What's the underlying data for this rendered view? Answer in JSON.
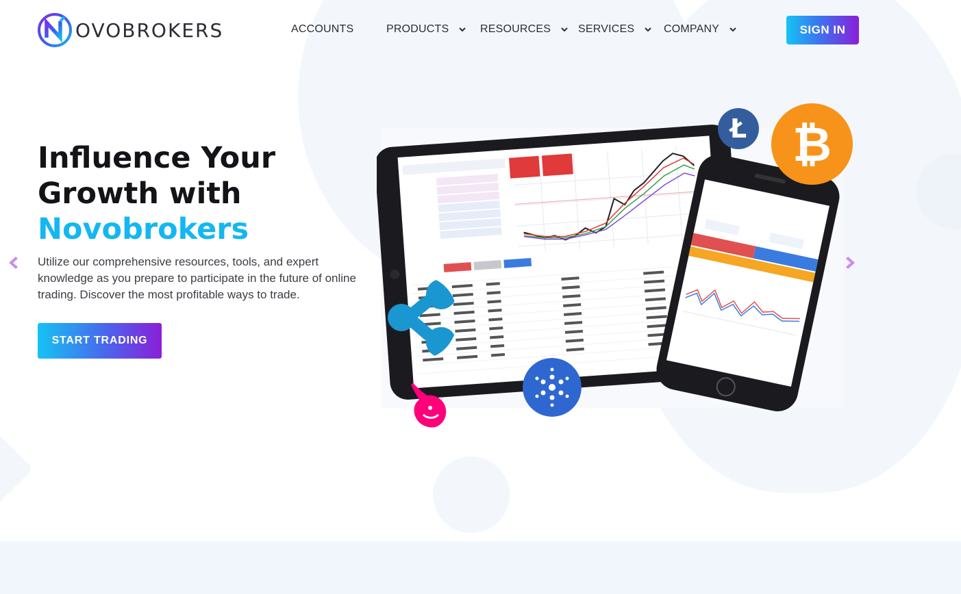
{
  "brand": {
    "logo_letter": "N",
    "name": "OVOBROKERS"
  },
  "nav": {
    "items": [
      {
        "label": "ACCOUNTS",
        "has_dropdown": false
      },
      {
        "label": "PRODUCTS",
        "has_dropdown": true
      },
      {
        "label": "RESOURCES",
        "has_dropdown": true
      },
      {
        "label": "SERVICES",
        "has_dropdown": true
      },
      {
        "label": "COMPANY",
        "has_dropdown": true
      }
    ],
    "signin_label": "SIGN IN"
  },
  "hero": {
    "title_line1": "Influence Your",
    "title_line2": "Growth with",
    "title_brand": "Novobrokers",
    "description": "Utilize our comprehensive resources, tools, and expert knowledge as you prepare to participate in the future of online trading. Discover the most profitable ways to trade.",
    "cta_label": "START TRADING"
  },
  "colors": {
    "accent_cyan": "#14b7f0",
    "gradient_start": "#16c3f4",
    "gradient_end": "#8a1fd8",
    "arrow": "#c98cf0"
  },
  "icons": {
    "prev": "chevron-left-icon",
    "next": "chevron-right-icon",
    "dropdown": "chevron-down-icon",
    "coins": [
      "litecoin-icon",
      "bitcoin-icon",
      "ripple-icon",
      "cardano-icon",
      "uniswap-icon"
    ]
  }
}
